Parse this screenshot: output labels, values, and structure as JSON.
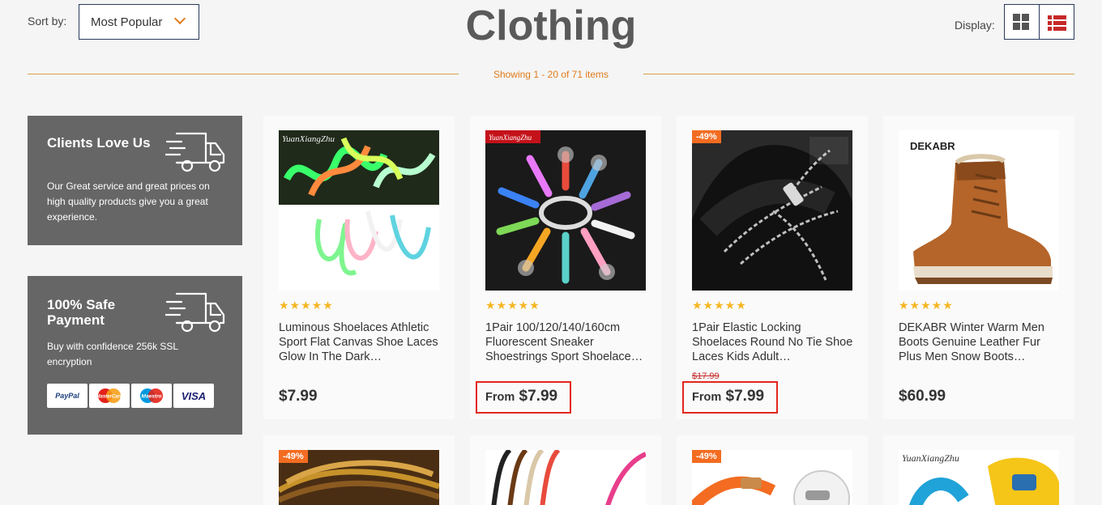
{
  "sort": {
    "label": "Sort by:",
    "value": "Most Popular"
  },
  "title": "Clothing",
  "display": {
    "label": "Display:"
  },
  "showing": "Showing 1 - 20 of 71 items",
  "promos": [
    {
      "title": "Clients Love Us",
      "text": "Our Great service and great prices on high quality products give you a great experience."
    },
    {
      "title": "100% Safe Payment",
      "text": "Buy with confidence 256k SSL encryption",
      "payments": [
        "PayPal",
        "MasterCard",
        "Maestro",
        "VISA"
      ]
    }
  ],
  "products": [
    {
      "watermark": "YuanXiangZhu",
      "rating": 5,
      "stars": "★★★★★",
      "name": "Luminous Shoelaces Athletic Sport Flat Canvas Shoe Laces Glow In The Dark…",
      "price": "$7.99"
    },
    {
      "watermark": "YuanXiangZhu",
      "rating": 5,
      "stars": "★★★★★",
      "name": "1Pair 100/120/140/160cm Fluorescent Sneaker Shoestrings Sport Shoelace…",
      "price_prefix": "From",
      "price": "$7.99"
    },
    {
      "badge": "-49%",
      "rating": 5,
      "stars": "★★★★★",
      "name": "1Pair Elastic Locking Shoelaces Round No Tie Shoe Laces Kids Adult…",
      "old_price": "$17.99",
      "price_prefix": "From",
      "price": "$7.99"
    },
    {
      "brand": "DEKABR",
      "rating": 4.5,
      "stars": "★★★★★",
      "name": "DEKABR Winter Warm Men Boots Genuine Leather Fur Plus Men Snow Boots…",
      "price": "$60.99"
    }
  ],
  "products_row2": [
    {
      "badge": "-49%"
    },
    {},
    {
      "badge": "-49%"
    },
    {
      "watermark": "YuanXiangZhu"
    }
  ],
  "colors": {
    "accent": "#e07b1a",
    "badge": "#f36c21",
    "highlight_box": "#e3261d",
    "star": "#f5b623"
  },
  "icons": [
    "chevron-down-icon",
    "grid-view-icon",
    "list-view-icon",
    "delivery-truck-icon"
  ]
}
